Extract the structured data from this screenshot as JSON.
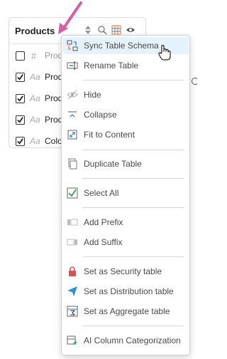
{
  "table": {
    "title": "Products",
    "rows": [
      {
        "type": "#",
        "name": "Prod",
        "checked": false
      },
      {
        "type": "Aa",
        "name": "Prod",
        "checked": true
      },
      {
        "type": "Aa",
        "name": "Prod",
        "checked": true
      },
      {
        "type": "Aa",
        "name": "Prod",
        "checked": true
      },
      {
        "type": "Aa",
        "name": "Colo",
        "checked": true
      }
    ]
  },
  "menu": {
    "items": [
      {
        "label": "Sync Table Schema",
        "icon": "sync-schema-icon"
      },
      {
        "label": "Rename Table",
        "icon": "rename-icon"
      },
      {
        "label": "Hide",
        "icon": "hide-eye-icon"
      },
      {
        "label": "Collapse",
        "icon": "collapse-icon"
      },
      {
        "label": "Fit to Content",
        "icon": "fit-content-icon"
      },
      {
        "label": "Duplicate Table",
        "icon": "duplicate-icon"
      },
      {
        "label": "Select All",
        "icon": "select-all-icon"
      },
      {
        "label": "Add Prefix",
        "icon": "prefix-icon"
      },
      {
        "label": "Add Suffix",
        "icon": "suffix-icon"
      },
      {
        "label": "Set as Security table",
        "icon": "lock-icon"
      },
      {
        "label": "Set as Distribution table",
        "icon": "send-icon"
      },
      {
        "label": "Set as Aggregate table",
        "icon": "aggregate-icon"
      },
      {
        "label": "AI Column Categorization",
        "icon": "ai-categorize-icon"
      }
    ]
  },
  "colors": {
    "accent_pink": "#d45fa6",
    "highlight": "#e5f1fb",
    "lock_red": "#d9534f",
    "send_blue": "#2b8fd6",
    "check_green": "#3a9d3a",
    "ai_green": "#37b24d"
  }
}
